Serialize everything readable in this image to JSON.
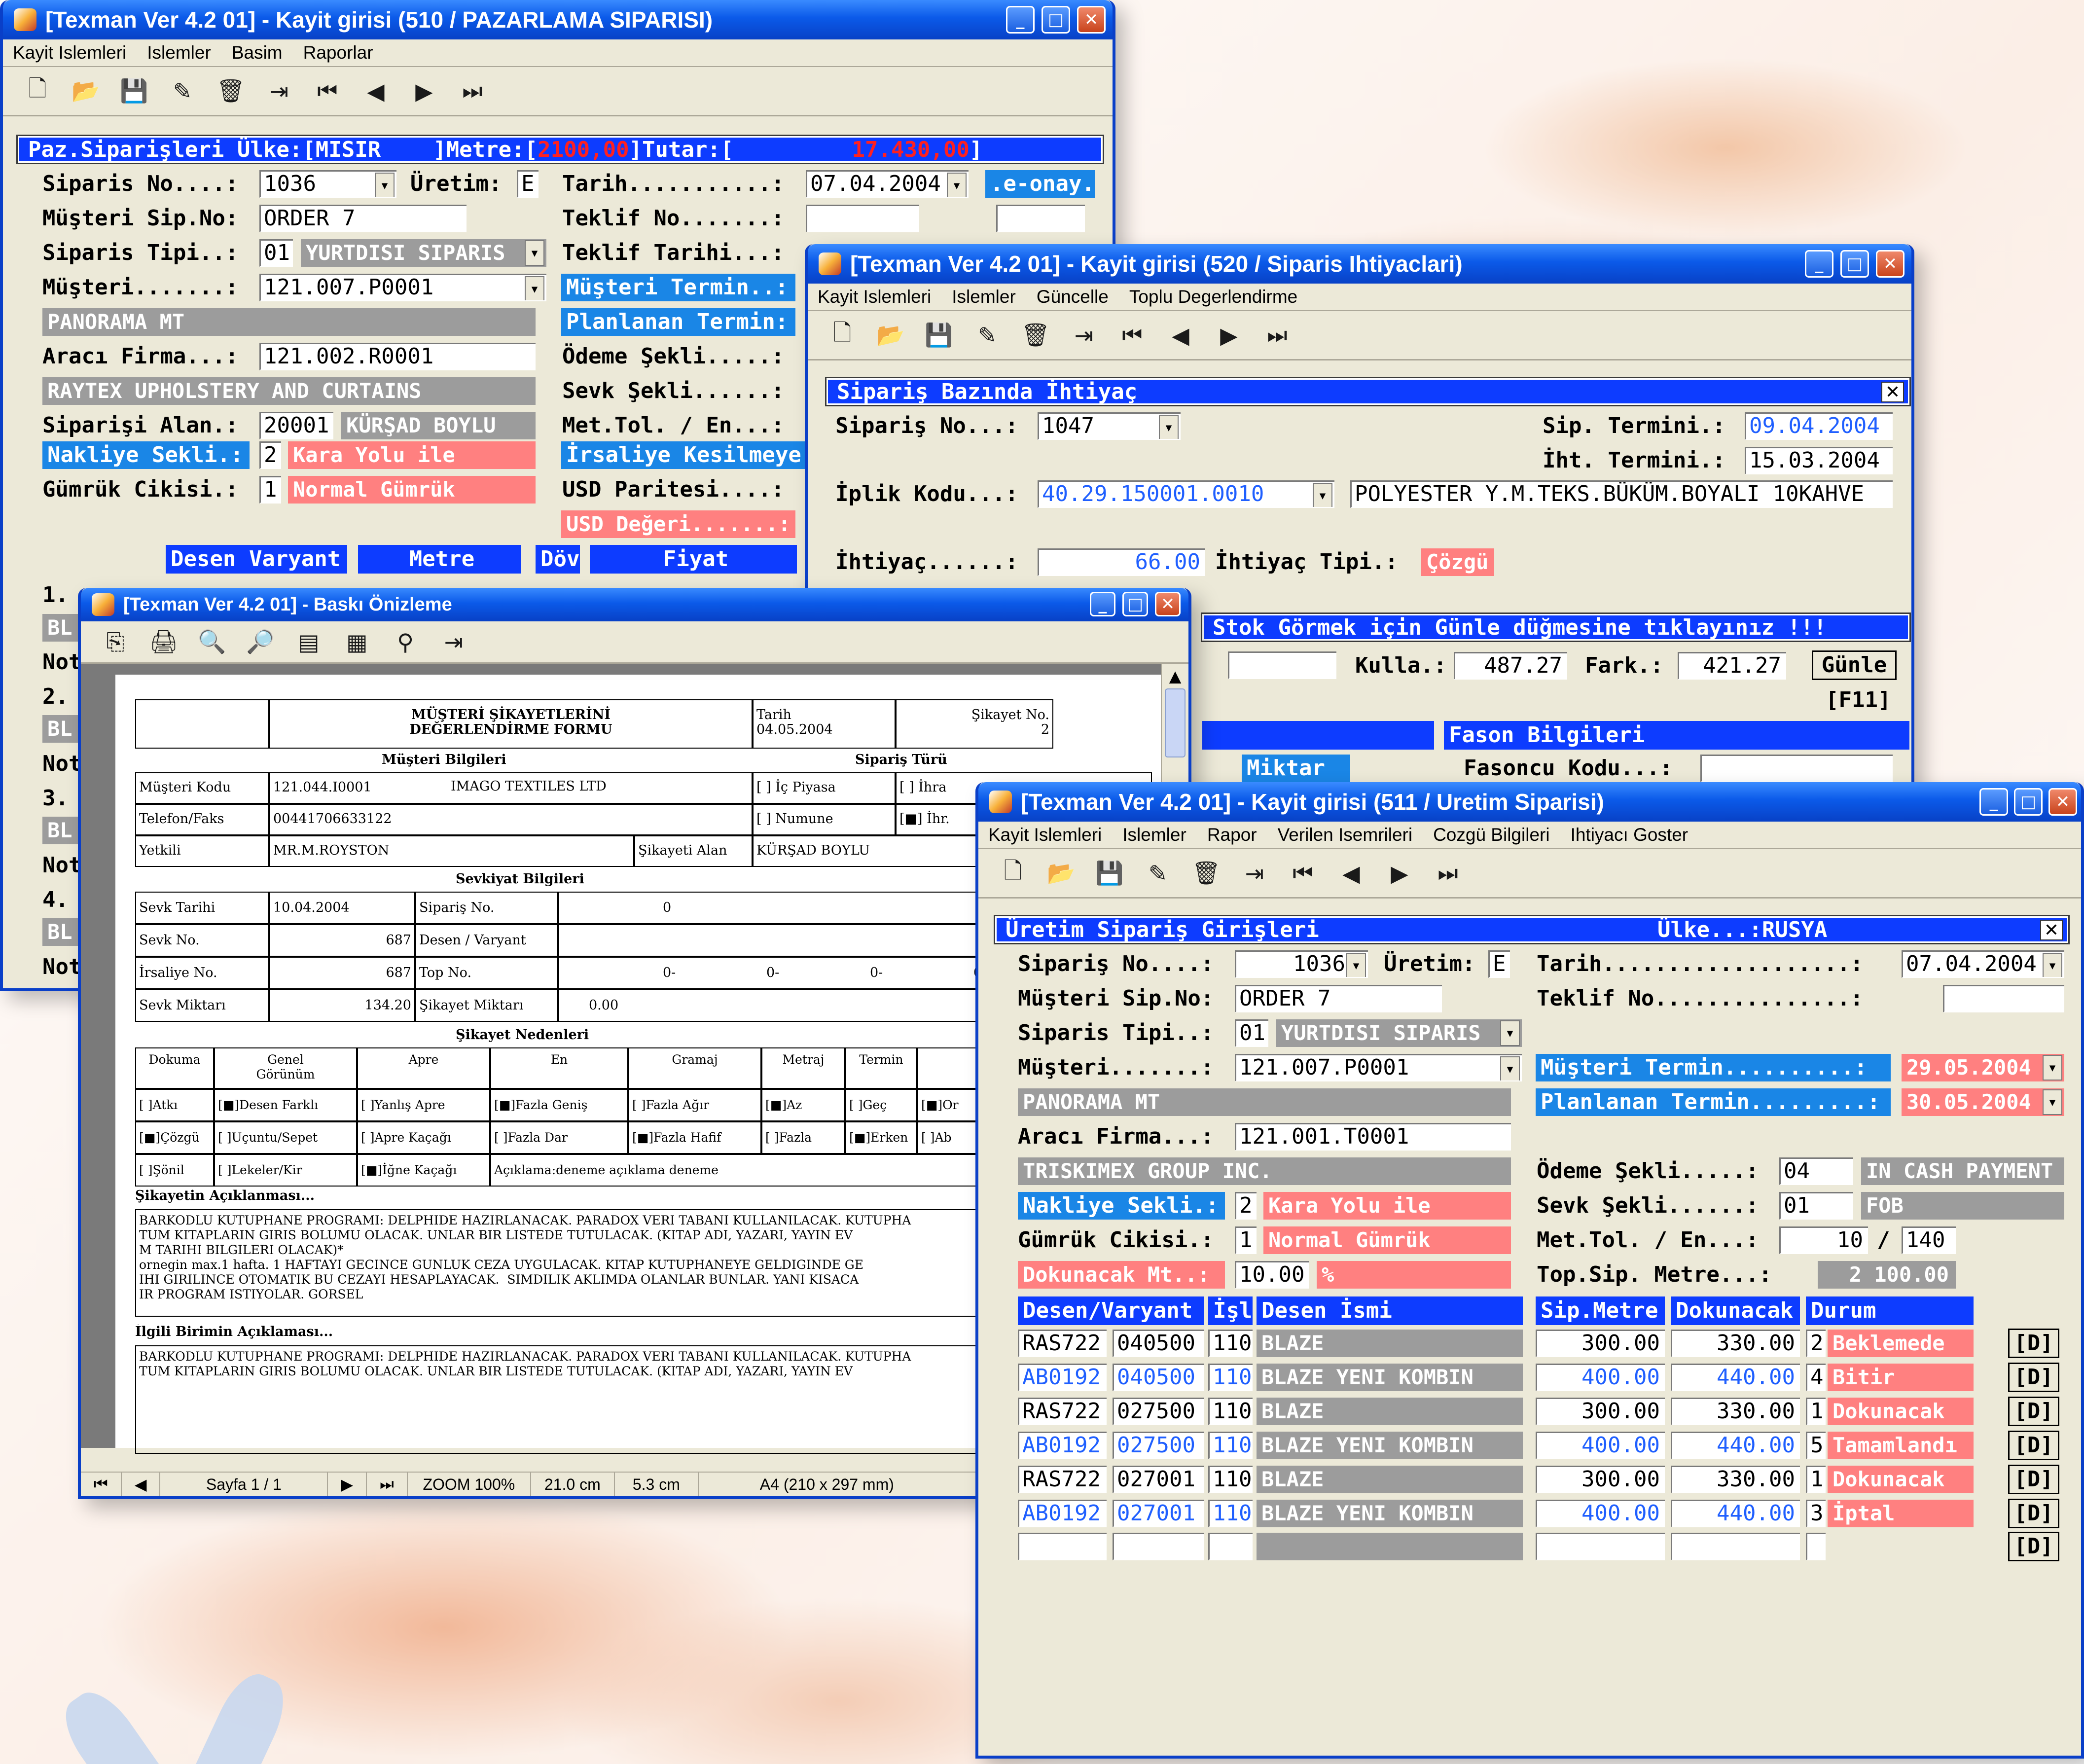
{
  "colors": {
    "title_blue": "#0b5ae9",
    "header_blue": "#0d3cff",
    "label_blue": "#1a86e6",
    "pink": "#ff8080",
    "gray": "#9c9c9c",
    "window_bg": "#ece9d8"
  },
  "w510": {
    "title": "[Texman Ver 4.2 01] - Kayit girisi (510 / PAZARLAMA SIPARISI)",
    "menu": [
      "Kayit Islemleri",
      "Islemler",
      "Basim",
      "Raporlar"
    ],
    "header_pre": "Paz.Siparişleri Ülke:[MISIR    ]Metre:[",
    "header_metre": "2100,00",
    "header_mid": "]Tutar:[",
    "header_tutar": "17.430,00",
    "header_end": "]",
    "labels": {
      "siparis_no": "Siparis No....:",
      "uretim": "Üretim:",
      "tarih": "Tarih...........:",
      "musteri_sip": "Müşteri Sip.No:",
      "teklif_no": "Teklif No.......:",
      "siparis_tipi": "Siparis Tipi..:",
      "teklif_tarihi": "Teklif Tarihi...:",
      "musteri": "Müşteri.......:",
      "araci": "Aracı Firma...:",
      "odeme": "Ödeme Şekli.....:",
      "sevk": "Sevk Şekli......:",
      "siparisi_alan": "Siparişi Alan.:",
      "met_tol": "Met.Tol. / En...:",
      "gumruk": "Gümrük Cikisi.:",
      "usd_paritesi": "USD Paritesi....:"
    },
    "values": {
      "siparis_no": "1036",
      "uretim": "E",
      "tarih": "07.04.2004",
      "musteri_sip": "ORDER 7",
      "siparis_tipi_code": "01",
      "siparis_tipi_name": "YURTDISI SIPARIS",
      "musteri": "121.007.P0001",
      "musteri_name": "PANORAMA MT",
      "araci": "121.002.R0001",
      "araci_name": "RAYTEX UPHOLSTERY AND CURTAINS",
      "siparisi_alan": "20001",
      "alan_name": "KÜRŞAD BOYLU",
      "nakliye_code": "2",
      "nakliye_name": "Kara Yolu ile",
      "gumruk_code": "1",
      "gumruk_name": "Normal Gümrük"
    },
    "blue_labels": {
      "e_onay": ".e-onay.",
      "musteri_termin": "Müşteri Termin..:",
      "planlanan": "Planlanan Termin:",
      "irsaliye": "İrsaliye Kesilmeye",
      "nakliye": "Nakliye Sekli.:"
    },
    "usd_degeri": "USD Değeri.......:",
    "cols": [
      "Desen Varyant",
      "Metre",
      "Döv",
      "Fiyat"
    ],
    "rows": [
      "1.",
      "BL",
      "Not",
      "2.",
      "BL",
      "Not",
      "3.",
      "BL",
      "Not",
      "4.",
      "BL",
      "Not"
    ]
  },
  "w520": {
    "title": "[Texman Ver 4.2 01] - Kayit girisi (520 / Siparis Ihtiyaclari)",
    "menu": [
      "Kayit Islemleri",
      "Islemler",
      "Güncelle",
      "Toplu Degerlendirme"
    ],
    "header": "Sipariş Bazında İhtiyaç",
    "labels": {
      "siparis_no": "Sipariş No...:",
      "sip_termini": "Sip. Termini.:",
      "iht_termini": "İht. Termini.:",
      "iplik": "İplik Kodu...:",
      "ihtiyac": "İhtiyaç......:",
      "ihtiyac_tipi": "İhtiyaç Tipi.:",
      "kulla": "Kulla.:",
      "fark": "Fark.:",
      "fasoncu": "Fasoncu Kodu...:"
    },
    "values": {
      "siparis_no": "1047",
      "sip_termini": "09.04.2004",
      "iht_termini": "15.03.2004",
      "iplik": "40.29.150001.0010",
      "iplik_name": "POLYESTER Y.M.TEKS.BÜKÜM.BOYALI 10KAHVE",
      "ihtiyac": "66.00",
      "ihtiyac_tipi": "Çözgü",
      "kulla": "487.27",
      "fark": "421.27"
    },
    "stok_msg": "Stok Görmek için Günle düğmesine tıklayınız !!!",
    "gunle": "Günle",
    "f11": "[F11]",
    "fason": "Fason Bilgileri",
    "miktar": "Miktar"
  },
  "preview": {
    "title": "[Texman Ver 4.2 01] - Baskı Önizleme",
    "status": {
      "page": "Sayfa 1 / 1",
      "zoom": "ZOOM 100%",
      "w": "21.0 cm",
      "h": "5.3 cm",
      "paper": "A4 (210 x 297 mm)"
    },
    "form_title": "MÜŞTERİ ŞİKAYETLERİNİ\nDEĞERLENDİRME FORMU",
    "tarih_l": "Tarih",
    "tarih_v": "04.05.2004",
    "sikayet_l": "Şikayet No.",
    "sikayet_v": "2",
    "musteri_bilgileri": "Müşteri Bilgileri",
    "siparis_turu": "Sipariş Türü",
    "r1": [
      "Müşteri Kodu",
      "121.044.I0001",
      "IMAGO TEXTILES LTD",
      "[ ] İç Piyasa",
      "[ ] İhra"
    ],
    "r2": [
      "Telefon/Faks",
      "00441706633122",
      "[ ] Numune",
      "[■] İhr."
    ],
    "r3": [
      "Yetkili",
      "MR.M.ROYSTON",
      "Şikayeti Alan",
      "KÜRŞAD BOYLU"
    ],
    "sevkiyat": "Sevkiyat Bilgileri",
    "s1": [
      "Sevk Tarihi",
      "10.04.2004",
      "Sipariş No.",
      "0"
    ],
    "s2": [
      "Sevk No.",
      "687",
      "Desen / Varyant"
    ],
    "s3": [
      "İrsaliye No.",
      "687",
      "Top No.",
      "0-",
      "0-",
      "0-",
      "0-"
    ],
    "s4": [
      "Sevk Miktarı",
      "134.20",
      "Şikayet Miktarı",
      "0.00"
    ],
    "nedenler": "Şikayet Nedenleri",
    "nh": [
      "Dokuma",
      "Genel\nGörünüm",
      "Apre",
      "En",
      "Gramaj",
      "Metraj",
      "Termin",
      "F"
    ],
    "n1": [
      "[ ]Atkı",
      "[■]Desen Farklı",
      "[ ]Yanlış Apre",
      "[■]Fazla Geniş",
      "[ ]Fazla Ağır",
      "[■]Az",
      "[ ]Geç",
      "[■]Or"
    ],
    "n2": [
      "[■]Çözgü",
      "[ ]Uçuntu/Sepet",
      "[ ]Apre Kaçağı",
      "[ ]Fazla Dar",
      "[■]Fazla Hafif",
      "[ ]Fazla",
      "[■]Erken",
      "[ ]Ab"
    ],
    "n3": [
      "[ ]Şönil",
      "[ ]Lekeler/Kir",
      "[■]İğne Kaçağı",
      "Açıklama:deneme açıklama deneme"
    ],
    "aciklama_h": "Şikayetin Açıklanması...",
    "aciklama": "BARKODLU KUTUPHANE PROGRAMI: DELPHIDE HAZIRLANACAK. PARADOX VERI TABANI KULLANILACAK. KUTUPHA\nTUM KITAPLARIN GIRIS BOLUMU OLACAK. UNLAR BIR LISTEDE TUTULACAK. (KITAP ADI, YAZARI, YAYIN EV\nM TARIHI BILGILERI OLACAK)*\nornegin max.1 hafta. 1 HAFTAYI GECINCE GUNLUK CEZA UYGULACAK. KITAP KUTUPHANEYE GELDIGINDE GE\nIHI GIRILINCE OTOMATIK BU CEZAYI HESAPLAYACAK.  SIMDILIK AKLIMDA OLANLAR BUNLAR. YANI KISACA\nIR PROGRAM ISTIYOLAR. GORSEL",
    "ilgili_h": "İlgili Birimin Açıklaması...",
    "ilgili": "BARKODLU KUTUPHANE PROGRAMI: DELPHIDE HAZIRLANACAK. PARADOX VERI TABANI KULLANILACAK. KUTUPHA\nTUM KITAPLARIN GIRIS BOLUMU OLACAK. UNLAR BIR LISTEDE TUTULACAK. (KITAP ADI, YAZARI, YAYIN EV"
  },
  "w511": {
    "title": "[Texman Ver 4.2 01] - Kayit girisi (511 / Uretim Siparisi)",
    "menu": [
      "Kayit Islemleri",
      "Islemler",
      "Rapor",
      "Verilen Isemrileri",
      "Cozgü Bilgileri",
      "Ihtiyacı Goster"
    ],
    "header": "Üretim Sipariş Girişleri",
    "ulke": "Ülke...:RUSYA",
    "labels": {
      "siparis_no": "Sipariş No....:",
      "uretim": "Üretim:",
      "tarih": "Tarih...................:",
      "musteri_sip": "Müşteri Sip.No:",
      "teklif_no": "Teklif No...............:",
      "siparis_tipi": "Siparis Tipi..:",
      "musteri": "Müşteri.......:",
      "araci": "Aracı Firma...:",
      "odeme": "Ödeme Şekli.....:",
      "sevk": "Sevk Şekli......:",
      "gumruk": "Gümrük Cikisi.:",
      "met_tol": "Met.Tol. / En...:",
      "top_sip": "Top.Sip. Metre...:",
      "slash": "/"
    },
    "blue_labels": {
      "musteri_termin": "Müşteri Termin..........:",
      "planlanan": "Planlanan Termin.........:",
      "nakliye": "Nakliye Sekli.:"
    },
    "values": {
      "siparis_no": "1036",
      "uretim": "E",
      "tarih": "07.04.2004",
      "musteri_sip": "ORDER 7",
      "siparis_tipi_code": "01",
      "siparis_tipi_name": "YURTDISI SIPARIS",
      "musteri": "121.007.P0001",
      "musteri_name": "PANORAMA MT",
      "musteri_termin": "29.05.2004",
      "planlanan": "30.05.2004",
      "araci": "121.001.T0001",
      "araci_name": "TRISKIMEX GROUP INC.",
      "odeme_code": "04",
      "odeme_name": "IN CASH PAYMENT",
      "sevk_code": "01",
      "sevk_name": "FOB",
      "nakliye_code": "2",
      "nakliye_name": "Kara Yolu ile",
      "gumruk_code": "1",
      "gumruk_name": "Normal Gümrük",
      "met_tol": "10",
      "en": "140",
      "dokunacak_label": "Dokunacak Mt..:",
      "dokunacak": "10.00",
      "pct": "%",
      "top_sip": "2 100.00"
    },
    "cols": [
      "Desen/Varyant",
      "İşl",
      "Desen İsmi",
      "Sip.Metre",
      "Dokunacak",
      "Durum"
    ],
    "rows": [
      {
        "desen": "RAS722",
        "varyant": "040500",
        "isl": "110",
        "isim": "BLAZE",
        "sip": "300.00",
        "dok": "330.00",
        "dcode": "2",
        "durum": "Beklemede",
        "d": "[D]",
        "blue": false
      },
      {
        "desen": "AB0192",
        "varyant": "040500",
        "isl": "110",
        "isim": "BLAZE YENI KOMBIN",
        "sip": "400.00",
        "dok": "440.00",
        "dcode": "4",
        "durum": "Bitir",
        "d": "[D]",
        "blue": true
      },
      {
        "desen": "RAS722",
        "varyant": "027500",
        "isl": "110",
        "isim": "BLAZE",
        "sip": "300.00",
        "dok": "330.00",
        "dcode": "1",
        "durum": "Dokunacak",
        "d": "[D]",
        "blue": false
      },
      {
        "desen": "AB0192",
        "varyant": "027500",
        "isl": "110",
        "isim": "BLAZE YENI KOMBIN",
        "sip": "400.00",
        "dok": "440.00",
        "dcode": "5",
        "durum": "Tamamlandı",
        "d": "[D]",
        "blue": true
      },
      {
        "desen": "RAS722",
        "varyant": "027001",
        "isl": "110",
        "isim": "BLAZE",
        "sip": "300.00",
        "dok": "330.00",
        "dcode": "1",
        "durum": "Dokunacak",
        "d": "[D]",
        "blue": false
      },
      {
        "desen": "AB0192",
        "varyant": "027001",
        "isl": "110",
        "isim": "BLAZE YENI KOMBIN",
        "sip": "400.00",
        "dok": "440.00",
        "dcode": "3",
        "durum": "İptal",
        "d": "[D]",
        "blue": true
      }
    ],
    "empty_d": "[D]"
  },
  "icons": {
    "min": "minimize-icon",
    "max": "maximize-icon",
    "close": "close-icon"
  }
}
